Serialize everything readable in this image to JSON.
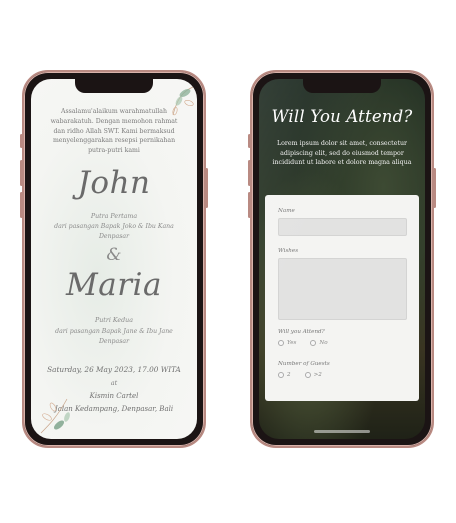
{
  "invitation": {
    "greeting": "Assalamu'alaikum warahmatullah wabarakatuh. Dengan memohon rahmat dan ridho Allah SWT. Kami bermaksud menyelenggarakan resepsi pernikahan putra-putri kami",
    "groom": {
      "name": "John",
      "title": "Putra Pertama",
      "parents": "dari pasangan Bapak Joko & Ibu Kana Denpasar"
    },
    "ampersand": "&",
    "bride": {
      "name": "Maria",
      "title": "Putri Kedua",
      "parents": "dari pasangan Bapak Jane & Ibu Jane Denpasar"
    },
    "event": {
      "date": "Saturday, 26 May 2023, 17.00 WITA",
      "at": "at",
      "venue": "Kismin Cartel",
      "address": "Jalan Kedampang, Denpasar, Bali"
    },
    "decoration_icon": "eucalyptus-leaf-icon"
  },
  "rsvp": {
    "title": "Will You Attend?",
    "description": "Lorem ipsum dolor sit amet, consectetur adipiscing elit, sed do eiusmod tempor incididunt ut labore et dolore magna aliqua",
    "form": {
      "name_label": "Name",
      "name_value": "",
      "wishes_label": "Wishes",
      "wishes_value": "",
      "attend_label": "Will you Attend?",
      "attend_options": [
        "Yes",
        "No"
      ],
      "guests_label": "Number of Guests",
      "guests_options": [
        "2",
        ">2"
      ]
    }
  },
  "colors": {
    "phone_frame": "#b98a82",
    "invite_bg": "#f4f5f2",
    "rsvp_bg": "#2c3826",
    "text_grey": "#6e6e6e"
  }
}
